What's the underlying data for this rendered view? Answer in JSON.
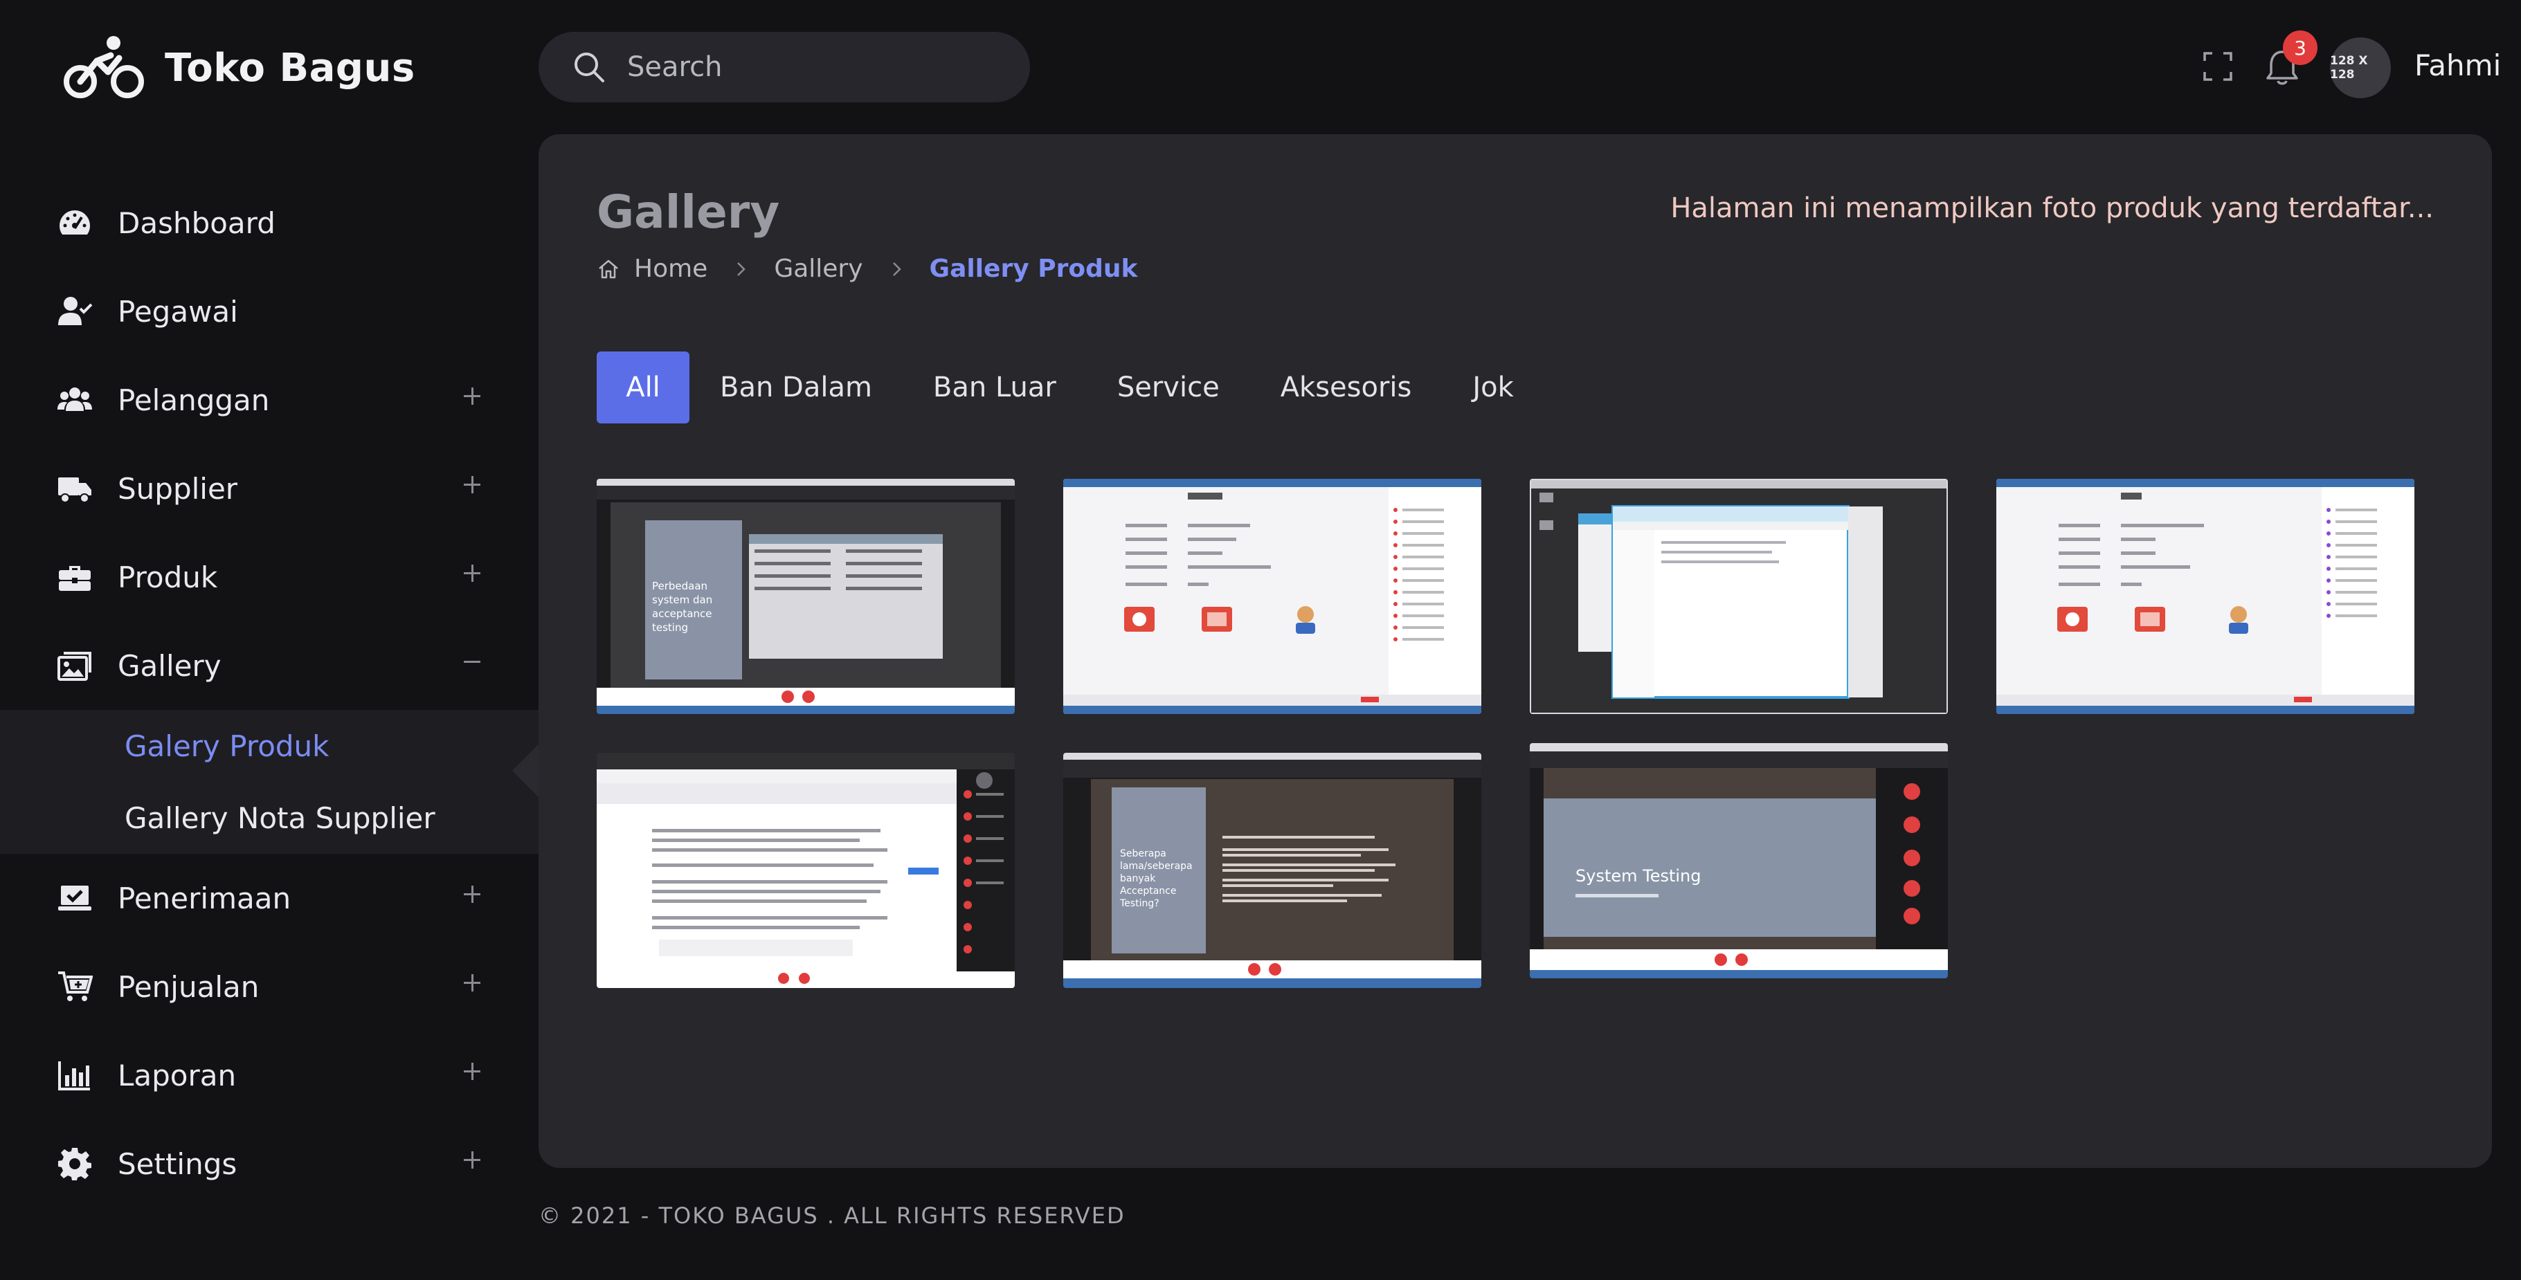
{
  "brand": {
    "name": "Toko Bagus",
    "logo_icon": "bicycle-icon"
  },
  "sidebar": {
    "items": [
      {
        "label": "Dashboard",
        "icon": "speedometer-icon",
        "expandable": false
      },
      {
        "label": "Pegawai",
        "icon": "user-check-icon",
        "expandable": false
      },
      {
        "label": "Pelanggan",
        "icon": "users-icon",
        "expandable": true
      },
      {
        "label": "Supplier",
        "icon": "truck-icon",
        "expandable": true
      },
      {
        "label": "Produk",
        "icon": "briefcase-icon",
        "expandable": true
      },
      {
        "label": "Gallery",
        "icon": "images-icon",
        "expandable": true,
        "expanded": true,
        "children": [
          {
            "label": "Galery Produk",
            "active": true
          },
          {
            "label": "Gallery Nota Supplier",
            "active": false
          }
        ]
      },
      {
        "label": "Penerimaan",
        "icon": "laptop-check-icon",
        "expandable": true
      },
      {
        "label": "Penjualan",
        "icon": "cart-plus-icon",
        "expandable": true
      },
      {
        "label": "Laporan",
        "icon": "bar-chart-icon",
        "expandable": true
      },
      {
        "label": "Settings",
        "icon": "gear-icon",
        "expandable": true
      }
    ]
  },
  "header": {
    "search_placeholder": "Search",
    "notification_count": "3",
    "avatar_text": "128 X 128",
    "user_name": "Fahmi"
  },
  "page": {
    "title": "Gallery",
    "description": "Halaman ini menampilkan foto produk yang terdaftar...",
    "breadcrumb": [
      "Home",
      "Gallery",
      "Gallery Produk"
    ]
  },
  "tabs": [
    "All",
    "Ban Dalam",
    "Ban Luar",
    "Service",
    "Aksesoris",
    "Jok"
  ],
  "gallery": {
    "images": [
      {
        "type": "presentation-dark",
        "slide_text": "Perbedaan system dan acceptance testing"
      },
      {
        "type": "meeting-info-white"
      },
      {
        "type": "file-explorer"
      },
      {
        "type": "meeting-info-white"
      },
      {
        "type": "document-editor"
      },
      {
        "type": "presentation-dark",
        "slide_text": "Seberapa lama/seberapa banyak Acceptance Testing?"
      },
      {
        "type": "presentation-blue",
        "slide_text": "System Testing"
      }
    ]
  },
  "footer": {
    "text": "© 2021 - TOKO BAGUS . ALL RIGHTS RESERVED"
  },
  "colors": {
    "accent": "#5b6ee8",
    "active_link": "#7c8cf2",
    "badge": "#e23b3b",
    "description": "#efc9c0"
  }
}
